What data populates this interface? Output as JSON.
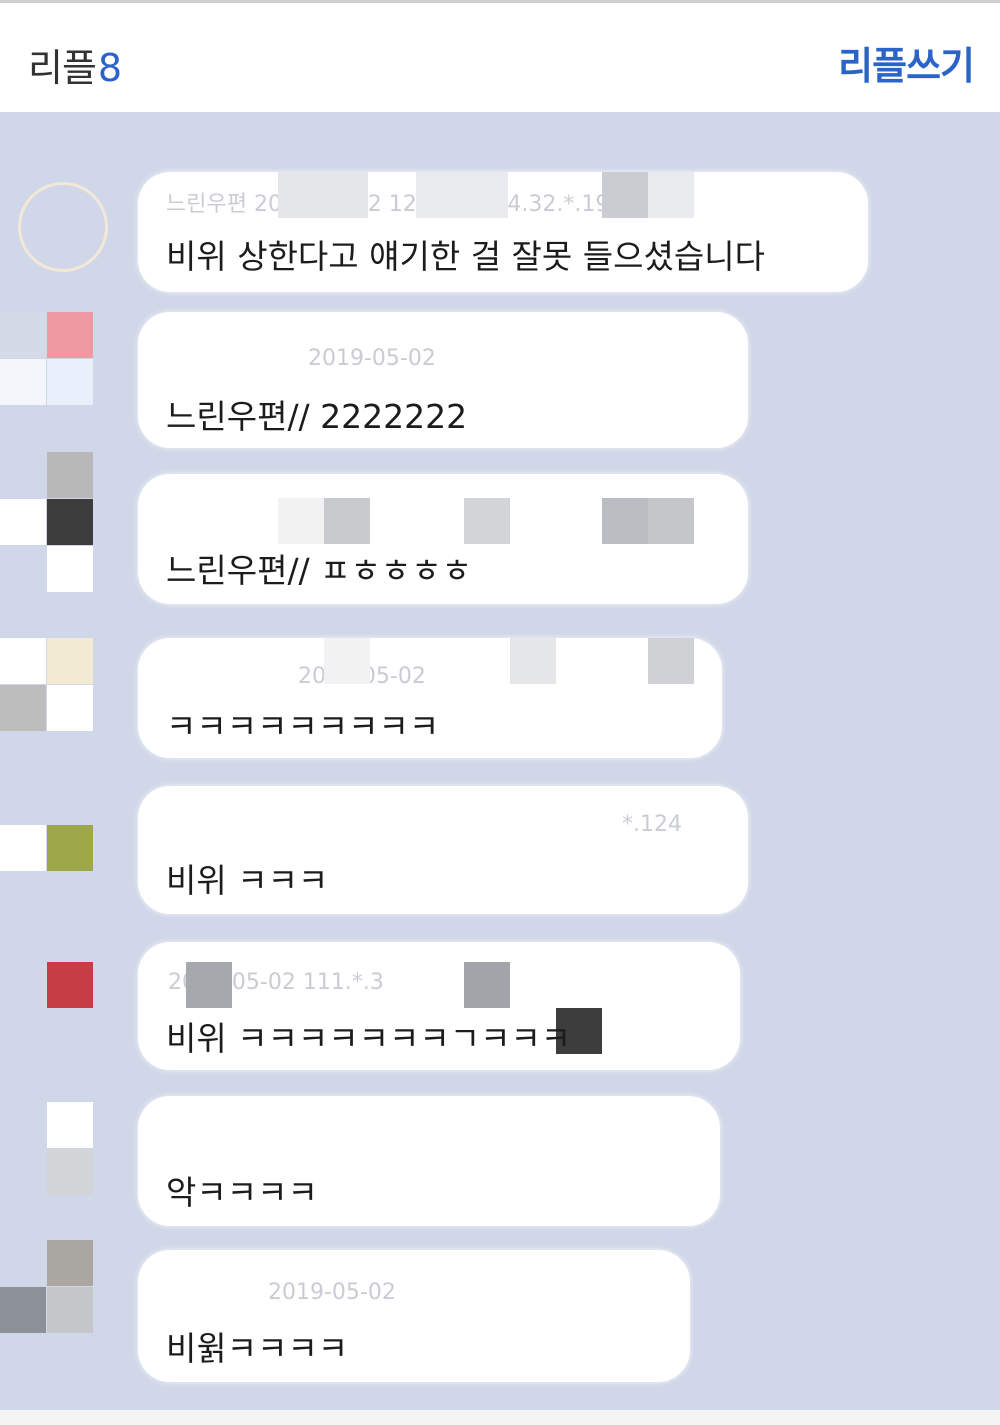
{
  "header": {
    "title": "리플",
    "count": "8",
    "write_label": "리플쓰기"
  },
  "comments": [
    {
      "meta": "느린우편 2019-05-02 12:31 IP: 14.32.*.191",
      "text": "비위 상한다고 얘기한 걸 잘못 들으셨습니다"
    },
    {
      "meta": "2019-05-02",
      "text": "느린우편// 2222222"
    },
    {
      "meta": "",
      "text": "느린우편// ㅍㅎㅎㅎㅎ"
    },
    {
      "meta": "2019-05-02",
      "text": "ㅋㅋㅋㅋㅋㅋㅋㅋㅋ"
    },
    {
      "meta": "*.124",
      "text": "비위 ㅋㅋㅋ"
    },
    {
      "meta": "2019-05-02 111.*.3",
      "text": "비위 ㅋㅋㅋㅋㅋㅋㅋㄱㅋㅋㅋ"
    },
    {
      "meta": "",
      "text": "악ㅋㅋㅋㅋ"
    },
    {
      "meta": "2019-05-02",
      "text": "비윍ㅋㅋㅋㅋ"
    }
  ],
  "colors": {
    "accent": "#2a64c8",
    "background": "#d0d7e8"
  }
}
